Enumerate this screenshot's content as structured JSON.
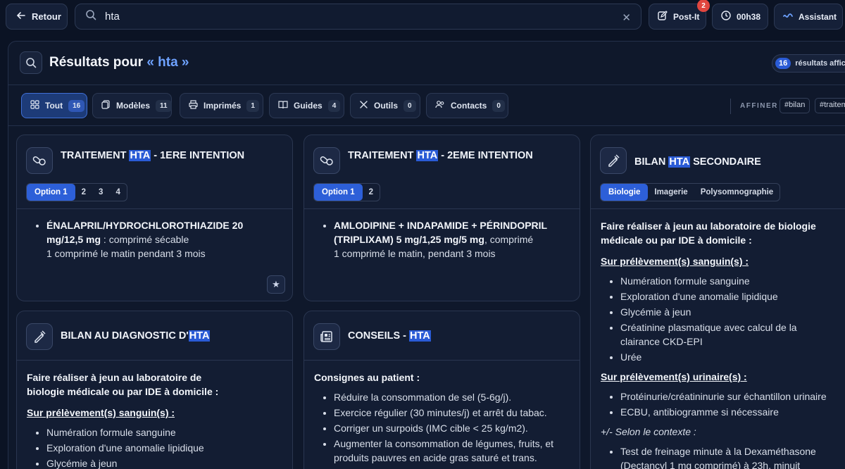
{
  "topbar": {
    "back_label": "Retour",
    "search_value": "hta",
    "postit_label": "Post-It",
    "postit_badge": "2",
    "timer_label": "00h38",
    "assistant_label": "Assistant"
  },
  "results": {
    "title_prefix": "Résultats pour",
    "query_display": "« hta »",
    "count": "16",
    "count_label": "résultats affichés"
  },
  "filters": [
    {
      "label": "Tout",
      "count": "16",
      "active": true
    },
    {
      "label": "Modèles",
      "count": "11"
    },
    {
      "label": "Imprimés",
      "count": "1"
    },
    {
      "label": "Guides",
      "count": "4"
    },
    {
      "label": "Outils",
      "count": "0"
    },
    {
      "label": "Contacts",
      "count": "0"
    }
  ],
  "affiner": {
    "label": "AFFINER",
    "tags": [
      "#bilan",
      "#traitement"
    ]
  },
  "cards": {
    "c1": {
      "title_a": "TRAITEMENT ",
      "title_hl": "HTA",
      "title_b": " - 1ERE INTENTION",
      "options": [
        "Option 1",
        "2",
        "3",
        "4"
      ],
      "drug": "ÉNALAPRIL/HYDROCHLOROTHIAZIDE 20 mg/12,5 mg",
      "form": " : comprimé sécable",
      "posology": "1 comprimé le matin pendant 3 mois"
    },
    "c2": {
      "title_a": "TRAITEMENT ",
      "title_hl": "HTA",
      "title_b": " - 2EME INTENTION",
      "options": [
        "Option 1",
        "2"
      ],
      "drug": "AMLODIPINE + INDAPAMIDE + PÉRINDOPRIL (TRIPLIXAM) 5 mg/1,25 mg/5 mg",
      "form": ", comprimé",
      "posology": "1 comprimé le matin, pendant 3 mois"
    },
    "c3": {
      "title_a": "BILAN ",
      "title_hl": "HTA",
      "title_b": " SECONDAIRE",
      "options": [
        "Biologie",
        "Imagerie",
        "Polysomnographie"
      ],
      "lead": "Faire réaliser à jeun au laboratoire de biologie médicale  ou par IDE à domicile :",
      "sang_title": "Sur prélèvement(s) sanguin(s) :",
      "sang": [
        "Numération formule sanguine",
        "Exploration d'une anomalie lipidique",
        "Glycémie à jeun",
        "Créatinine plasmatique avec calcul de la clairance CKD-EPI",
        "Urée"
      ],
      "urine_title": "Sur prélèvement(s) urinaire(s) :",
      "urine": [
        "Protéinurie/créatininurie sur échantillon urinaire",
        "ECBU, antibiogramme si nécessaire"
      ],
      "context": "+/- Selon le contexte :",
      "context_items": [
        "Test de freinage minute à la Dexaméthasone (Dectancyl 1 mg comprimé) à 23h, minuit"
      ]
    },
    "c4": {
      "title_a": "BILAN AU DIAGNOSTIC D'",
      "title_hl": "HTA",
      "title_b": "",
      "lead": "Faire réaliser à jeun au laboratoire de biologie médicale  ou par IDE à domicile :",
      "sang_title": "Sur prélèvement(s) sanguin(s) :",
      "sang": [
        "Numération formule sanguine",
        "Exploration d'une anomalie lipidique",
        "Glycémie à jeun"
      ]
    },
    "c5": {
      "title_a": "CONSEILS - ",
      "title_hl": "HTA",
      "title_b": "",
      "lead": "Consignes au patient :",
      "items": [
        "Réduire la consommation de sel (5-6g/j).",
        "Exercice régulier (30 minutes/j) et arrêt du tabac.",
        "Corriger un surpoids (IMC cible < 25 kg/m2).",
        "Augmenter la consommation de légumes, fruits, et produits pauvres en acide gras saturé et trans."
      ]
    }
  }
}
